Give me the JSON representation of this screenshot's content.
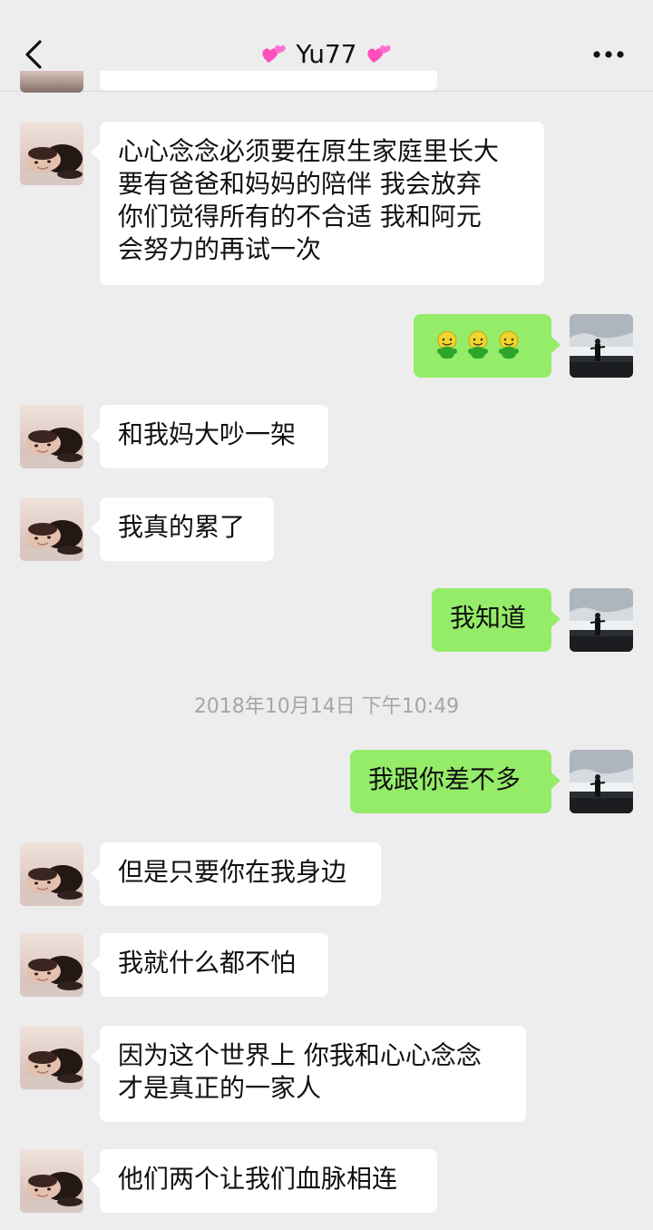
{
  "header": {
    "title": "Yu77",
    "back_icon": "chevron-left-icon",
    "more_icon": "more-dots-icon",
    "title_decoration": "two-hearts-emoji"
  },
  "messages": [
    {
      "side": "left",
      "lines": [
        "心心念念必须要在原生家庭里长大",
        "要有爸爸和妈妈的陪伴 我会放弃",
        "你们觉得所有的不合适 我和阿元",
        "会努力的再试一次"
      ]
    },
    {
      "side": "right",
      "content": [
        "smiling-green-emoji",
        "smiling-green-emoji",
        "smiling-green-emoji"
      ]
    },
    {
      "side": "left",
      "text": "和我妈大吵一架"
    },
    {
      "side": "left",
      "text": "我真的累了"
    },
    {
      "side": "right",
      "text": "我知道"
    },
    {
      "timestamp": "2018年10月14日 下午10:49"
    },
    {
      "side": "right",
      "text": "我跟你差不多"
    },
    {
      "side": "left",
      "text": "但是只要你在我身边"
    },
    {
      "side": "left",
      "text": "我就什么都不怕"
    },
    {
      "side": "left",
      "lines": [
        "因为这个世界上 你我和心心念念",
        "才是真正的一家人"
      ]
    },
    {
      "side": "left",
      "text": "他们两个让我们血脉相连"
    }
  ],
  "colors": {
    "background": "#ededed",
    "sent_bubble": "#95ec69",
    "received_bubble": "#ffffff",
    "timestamp_text": "#a6a6a6"
  }
}
